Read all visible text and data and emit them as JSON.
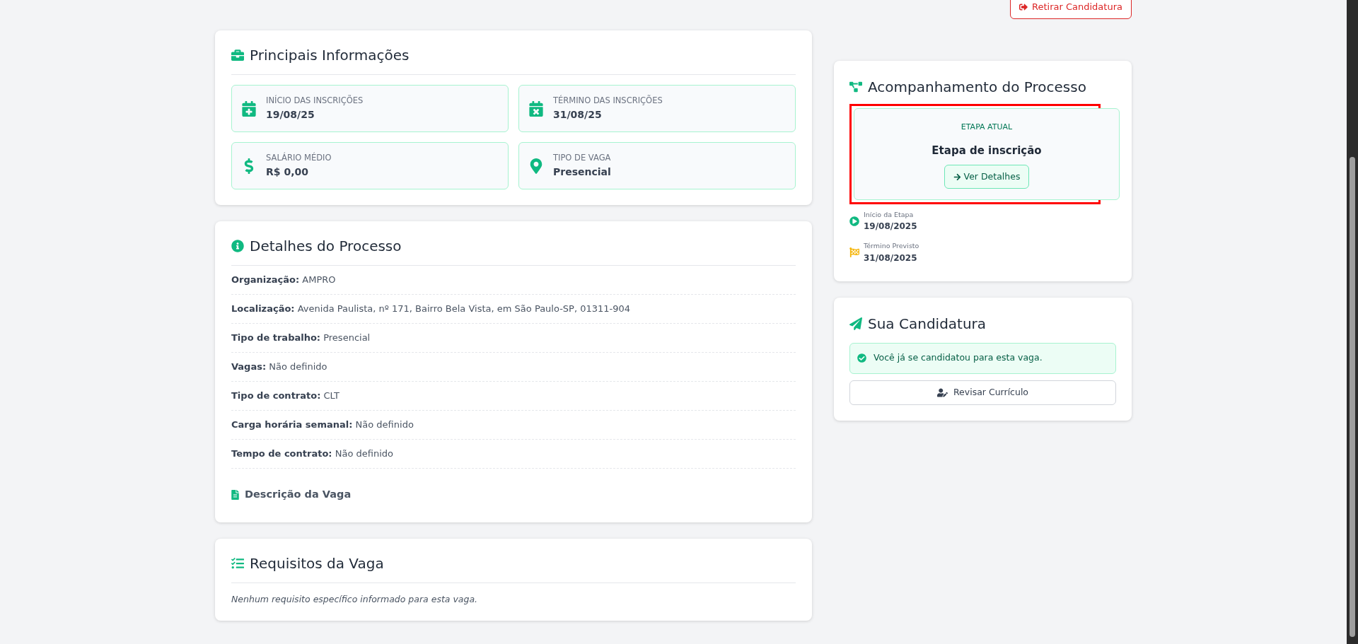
{
  "withdraw_button": {
    "label": "Retirar Candidatura"
  },
  "main_info": {
    "title": "Principais Informações",
    "items": [
      {
        "kind": "start",
        "label": "INÍCIO DAS INSCRIÇÕES",
        "value": "19/08/25"
      },
      {
        "kind": "end",
        "label": "TÉRMINO DAS INSCRIÇÕES",
        "value": "31/08/25"
      },
      {
        "kind": "salary",
        "label": "SALÁRIO MÉDIO",
        "value": "R$ 0,00"
      },
      {
        "kind": "location",
        "label": "TIPO DE VAGA",
        "value": "Presencial"
      }
    ]
  },
  "process_details": {
    "title": "Detalhes do Processo",
    "rows": [
      {
        "label": "Organização:",
        "value": "AMPRO"
      },
      {
        "label": "Localização:",
        "value": "Avenida Paulista, nº 171, Bairro Bela Vista, em São Paulo-SP, 01311-904"
      },
      {
        "label": "Tipo de trabalho:",
        "value": "Presencial"
      },
      {
        "label": "Vagas:",
        "value": "Não definido"
      },
      {
        "label": "Tipo de contrato:",
        "value": "CLT"
      },
      {
        "label": "Carga horária semanal:",
        "value": "Não definido"
      },
      {
        "label": "Tempo de contrato:",
        "value": "Não definido"
      }
    ],
    "description_heading": "Descrição da Vaga"
  },
  "requirements": {
    "title": "Requisitos da Vaga",
    "empty_text": "Nenhum requisito específico informado para esta vaga."
  },
  "tracking": {
    "title": "Acompanhamento do Processo",
    "current_stage": {
      "caption": "ETAPA ATUAL",
      "name": "Etapa de inscrição",
      "button": "Ver Detalhes",
      "highlighted": true
    },
    "dates": [
      {
        "kind": "start",
        "label": "Início da Etapa",
        "value": "19/08/2025"
      },
      {
        "kind": "end",
        "label": "Término Previsto",
        "value": "31/08/2025"
      }
    ]
  },
  "application": {
    "title": "Sua Candidatura",
    "notice": "Você já se candidatou para esta vaga.",
    "button": "Revisar Currículo"
  }
}
